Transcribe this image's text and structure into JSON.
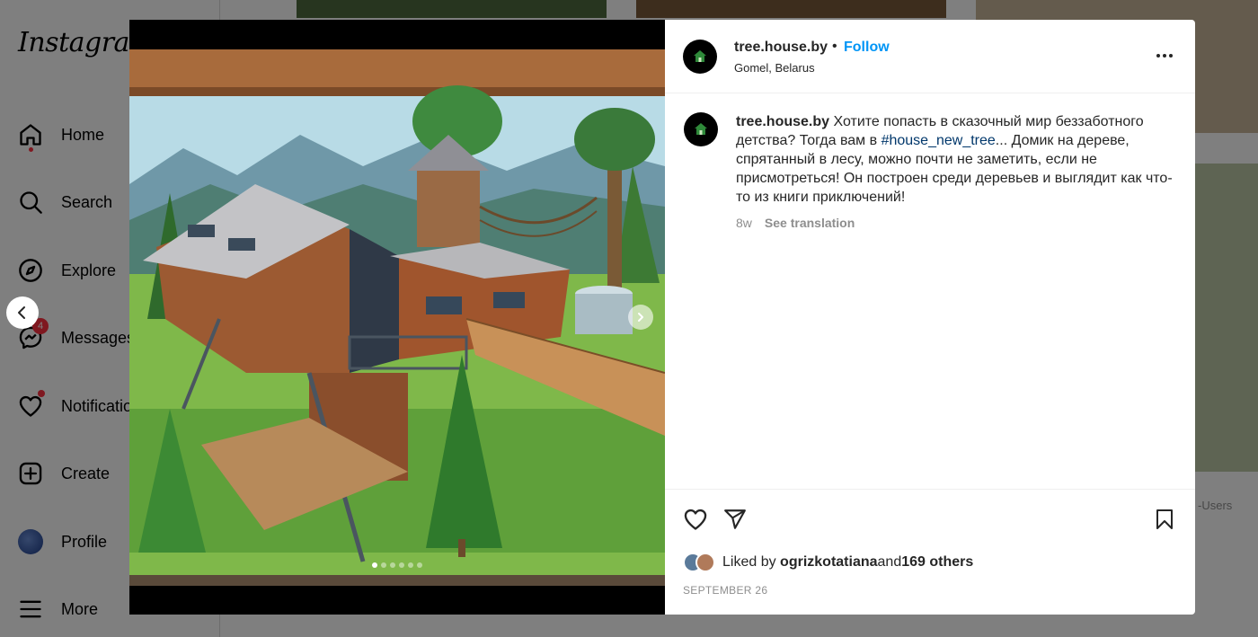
{
  "sidebar": {
    "logo": "Instagram",
    "items": [
      {
        "label": "Home",
        "icon": "home-icon"
      },
      {
        "label": "Search",
        "icon": "search-icon"
      },
      {
        "label": "Explore",
        "icon": "explore-icon"
      },
      {
        "label": "Messages",
        "icon": "messenger-icon",
        "badge": "4"
      },
      {
        "label": "Notifications",
        "icon": "heart-icon"
      },
      {
        "label": "Create",
        "icon": "create-icon"
      },
      {
        "label": "Profile",
        "icon": "avatar"
      },
      {
        "label": "More",
        "icon": "menu-icon"
      }
    ]
  },
  "background": {
    "users_text": "-Users"
  },
  "post": {
    "username": "tree.house.by",
    "separator": "•",
    "follow_label": "Follow",
    "location": "Gomel, Belarus",
    "caption": {
      "username": "tree.house.by",
      "text_before_tag": " Хотите попасть в сказочный мир беззаботного детства? Тогда вам в ",
      "hashtag": "#house_new_tree",
      "text_after_tag": "... Домик на дереве, спрятанный в лесу, можно почти не заметить, если не присмотреться! Он построен среди деревьев и выглядит как что-то из книги приключений!",
      "age": "8w",
      "see_translation": "See translation"
    },
    "likes": {
      "prefix": "Liked by ",
      "first_liker": "ogrizkotatiana",
      "middle": " and ",
      "others": "169 others"
    },
    "date": "SEPTEMBER 26",
    "carousel": {
      "total_slides": 6,
      "active_slide": 1
    }
  },
  "colors": {
    "accent": "#0095f6",
    "hashtag": "#00376b",
    "badge": "#ff3040",
    "muted": "#8e8e8e"
  }
}
